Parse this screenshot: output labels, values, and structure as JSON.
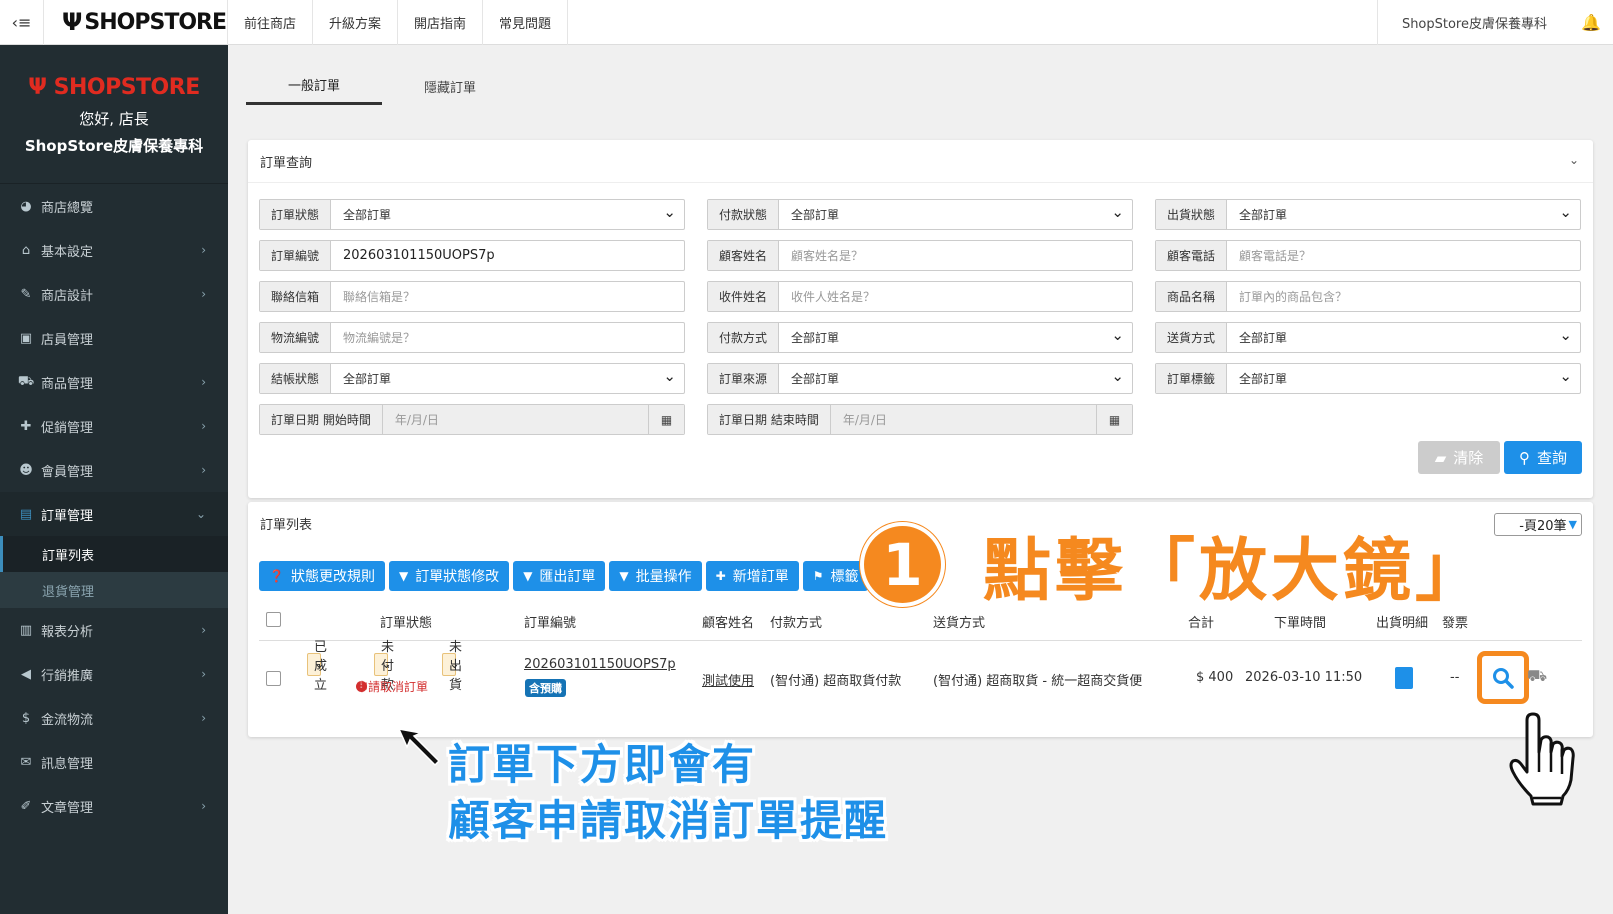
{
  "topbar": {
    "brand": "SHOPSTORE",
    "nav": [
      "前往商店",
      "升級方案",
      "開店指南",
      "常見問題"
    ],
    "store_name": "ShopStore皮膚保養專科"
  },
  "sidebar": {
    "logo": "SHOPSTORE",
    "greeting": "您好, 店長",
    "store_name": "ShopStore皮膚保養專科",
    "items": [
      {
        "label": "商店總覽",
        "icon": "dashboard-icon"
      },
      {
        "label": "基本設定",
        "icon": "bank-icon"
      },
      {
        "label": "商店設計",
        "icon": "magic-wand-icon"
      },
      {
        "label": "店員管理",
        "icon": "lock-icon"
      },
      {
        "label": "商品管理",
        "icon": "cart-icon"
      },
      {
        "label": "促銷管理",
        "icon": "gift-icon"
      },
      {
        "label": "會員管理",
        "icon": "users-icon"
      },
      {
        "label": "訂單管理",
        "icon": "file-icon"
      },
      {
        "label": "報表分析",
        "icon": "bar-chart-icon"
      },
      {
        "label": "行銷推廣",
        "icon": "bullhorn-icon"
      },
      {
        "label": "金流物流",
        "icon": "dollar-icon"
      },
      {
        "label": "訊息管理",
        "icon": "comments-icon"
      },
      {
        "label": "文章管理",
        "icon": "edit-icon"
      }
    ],
    "sub_items": [
      "訂單列表",
      "退貨管理"
    ]
  },
  "tabs": [
    "一般訂單",
    "隱藏訂單"
  ],
  "query": {
    "title": "訂單查詢",
    "fields": [
      {
        "label": "訂單狀態",
        "value": "全部訂單"
      },
      {
        "label": "付款狀態",
        "value": "全部訂單"
      },
      {
        "label": "出貨狀態",
        "value": "全部訂單"
      },
      {
        "label": "訂單編號",
        "value": "202603101150UOPS7p"
      },
      {
        "label": "顧客姓名",
        "placeholder": "顧客姓名是？"
      },
      {
        "label": "顧客電話",
        "placeholder": "顧客電話是？"
      },
      {
        "label": "聯絡信箱",
        "placeholder": "聯絡信箱是？"
      },
      {
        "label": "收件姓名",
        "placeholder": "收件人姓名是？"
      },
      {
        "label": "商品名稱",
        "placeholder": "訂單內的商品包含？"
      },
      {
        "label": "物流編號",
        "placeholder": "物流編號是？"
      },
      {
        "label": "付款方式",
        "value": "全部訂單"
      },
      {
        "label": "送貨方式",
        "value": "全部訂單"
      },
      {
        "label": "結帳狀態",
        "value": "全部訂單"
      },
      {
        "label": "訂單來源",
        "value": "全部訂單"
      },
      {
        "label": "訂單標籤",
        "value": "全部訂單"
      },
      {
        "label": "訂單日期 開始時間",
        "placeholder": "年/月/日"
      },
      {
        "label": "訂單日期 結束時間",
        "placeholder": "年/月/日"
      }
    ],
    "clear_label": "清除",
    "search_label": "查詢"
  },
  "list": {
    "title": "訂單列表",
    "per_page": "-頁20筆",
    "actions": [
      {
        "label": "狀態更改規則",
        "icon": "question-icon"
      },
      {
        "label": "訂單狀態修改",
        "icon": "caret-down-icon"
      },
      {
        "label": "匯出訂單",
        "icon": "caret-down-icon"
      },
      {
        "label": "批量操作",
        "icon": "caret-down-icon"
      },
      {
        "label": "新增訂單",
        "icon": "plus-icon"
      },
      {
        "label": "標籤",
        "icon": "tag-icon"
      }
    ],
    "columns": [
      "訂單狀態",
      "訂單編號",
      "顧客姓名",
      "付款方式",
      "送貨方式",
      "合計",
      "下單時間",
      "出貨明細",
      "發票"
    ],
    "row": {
      "status": [
        "已成立",
        "未付款",
        "未出貨"
      ],
      "cancel_request": "申請取消訂單",
      "order_id": "202603101150UOPS7p",
      "badge": "含預購",
      "customer": "測試使用",
      "payment": "(智付通) 超商取貨付款",
      "shipping": "(智付通) 超商取貨 - 統一超商交貨便",
      "total": "$ 400",
      "time": "2026-03-10 11:50",
      "invoice": "--"
    }
  },
  "annotations": {
    "step_number": "1",
    "step_text": "點擊「放大鏡」",
    "note_line1": "訂單下方即會有",
    "note_line2": "顧客申請取消訂單提醒"
  },
  "colors": {
    "accent": "#1e90e8",
    "annotation_orange": "#f5891f",
    "sidebar_bg": "#222d32",
    "brand_red": "#e02b20",
    "warning_red": "#d32f2f"
  }
}
